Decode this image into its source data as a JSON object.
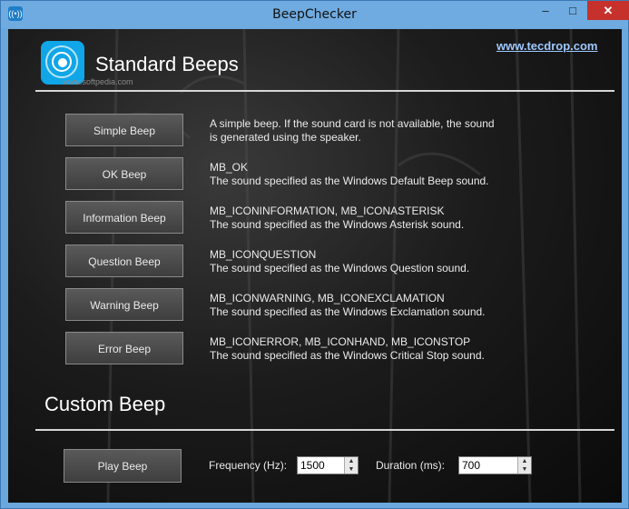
{
  "window": {
    "title": "BeepChecker",
    "min_label": "–",
    "max_label": "□",
    "close_label": "✕"
  },
  "header": {
    "title": "Standard Beeps",
    "link": "www.tecdrop.com",
    "watermark": "www.softpedia.com"
  },
  "beeps": [
    {
      "label": "Simple Beep",
      "line1": "A simple beep. If the sound card is not available, the sound",
      "line2": "is generated using the speaker."
    },
    {
      "label": "OK Beep",
      "line1": "MB_OK",
      "line2": "The sound specified as the Windows Default Beep sound."
    },
    {
      "label": "Information Beep",
      "line1": "MB_ICONINFORMATION, MB_ICONASTERISK",
      "line2": "The sound specified as the Windows Asterisk sound."
    },
    {
      "label": "Question Beep",
      "line1": "MB_ICONQUESTION",
      "line2": "The sound specified as the Windows Question sound."
    },
    {
      "label": "Warning Beep",
      "line1": "MB_ICONWARNING, MB_ICONEXCLAMATION",
      "line2": "The sound specified as the Windows Exclamation sound."
    },
    {
      "label": "Error Beep",
      "line1": "MB_ICONERROR, MB_ICONHAND, MB_ICONSTOP",
      "line2": "The sound specified as the Windows Critical Stop sound."
    }
  ],
  "custom": {
    "title": "Custom Beep",
    "play_label": "Play Beep",
    "frequency_label": "Frequency (Hz):",
    "frequency_value": "1500",
    "duration_label": "Duration (ms):",
    "duration_value": "700"
  },
  "icons": [
    "app-icon",
    "speaker-waves-icon",
    "up-arrow-icon",
    "down-arrow-icon"
  ]
}
